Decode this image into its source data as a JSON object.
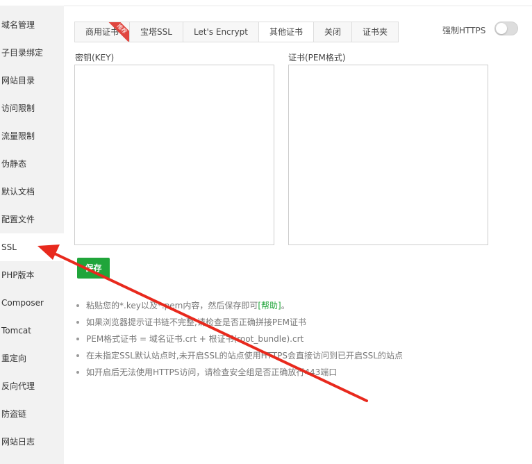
{
  "sidebar": {
    "items": [
      {
        "label": "域名管理"
      },
      {
        "label": "子目录绑定"
      },
      {
        "label": "网站目录"
      },
      {
        "label": "访问限制"
      },
      {
        "label": "流量限制"
      },
      {
        "label": "伪静态"
      },
      {
        "label": "默认文档"
      },
      {
        "label": "配置文件"
      },
      {
        "label": "SSL"
      },
      {
        "label": "PHP版本"
      },
      {
        "label": "Composer"
      },
      {
        "label": "Tomcat"
      },
      {
        "label": "重定向"
      },
      {
        "label": "反向代理"
      },
      {
        "label": "防盗链"
      },
      {
        "label": "网站日志"
      }
    ],
    "active_index": 8
  },
  "tabs": [
    {
      "label": "商用证书",
      "badge": "推荐"
    },
    {
      "label": "宝塔SSL"
    },
    {
      "label": "Let's Encrypt"
    },
    {
      "label": "其他证书"
    },
    {
      "label": "关闭"
    },
    {
      "label": "证书夹"
    }
  ],
  "active_tab": 3,
  "force_https": {
    "label": "强制HTTPS",
    "enabled": false
  },
  "key_field": {
    "label": "密钥(KEY)",
    "value": ""
  },
  "cert_field": {
    "label": "证书(PEM格式)",
    "value": ""
  },
  "save_label": "保存",
  "tips": {
    "t1_text": "粘贴您的*.key以及*.pem内容，然后保存即可",
    "t1_link": "[帮助]",
    "t1_end": "。",
    "t2": "如果浏览器提示证书链不完整,请检查是否正确拼接PEM证书",
    "t3": "PEM格式证书 = 域名证书.crt + 根证书(root_bundle).crt",
    "t4": "在未指定SSL默认站点时,未开启SSL的站点使用HTTPS会直接访问到已开启SSL的站点",
    "t5": "如开启后无法使用HTTPS访问，请检查安全组是否正确放行443端口"
  },
  "colors": {
    "accent": "#20a53a",
    "arrow": "#e8291d",
    "badge": "#e0463f"
  }
}
